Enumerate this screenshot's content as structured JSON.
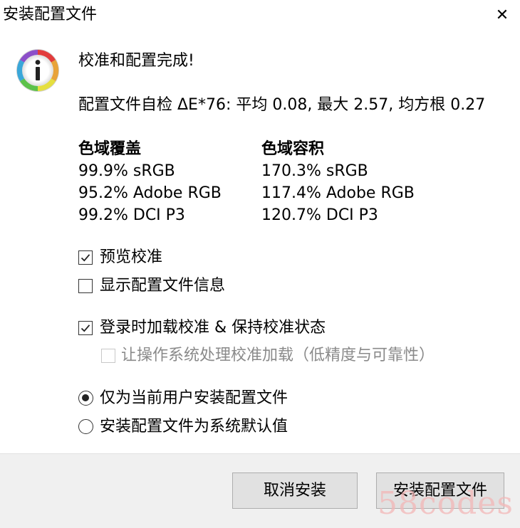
{
  "window": {
    "title": "安装配置文件"
  },
  "header": {
    "message": "校准和配置完成!"
  },
  "self_check": {
    "text": "配置文件自检 ΔE*76: 平均 0.08, 最大 2.57, 均方根 0.27"
  },
  "gamut": {
    "coverage_heading": "色域覆盖",
    "coverage": [
      "99.9% sRGB",
      "95.2% Adobe RGB",
      "99.2% DCI P3"
    ],
    "volume_heading": "色域容积",
    "volume": [
      "170.3% sRGB",
      "117.4% Adobe RGB",
      "120.7% DCI P3"
    ]
  },
  "options": {
    "preview": {
      "label": "预览校准",
      "checked": true
    },
    "show_info": {
      "label": "显示配置文件信息",
      "checked": false
    },
    "load_on_login": {
      "label": "登录时加载校准 & 保持校准状态",
      "checked": true
    },
    "os_load": {
      "label": "让操作系统处理校准加载（低精度与可靠性）",
      "checked": false,
      "enabled": false
    }
  },
  "install_scope": {
    "current_user": {
      "label": "仅为当前用户安装配置文件",
      "selected": true
    },
    "system_default": {
      "label": "安装配置文件为系统默认值",
      "selected": false
    }
  },
  "buttons": {
    "cancel": "取消安装",
    "install": "安装配置文件"
  },
  "watermark": "58codes",
  "colors": {
    "footer_bg": "#f0f0f0",
    "button_bg": "#e1e1e1",
    "disabled_text": "#8a8a8a"
  }
}
